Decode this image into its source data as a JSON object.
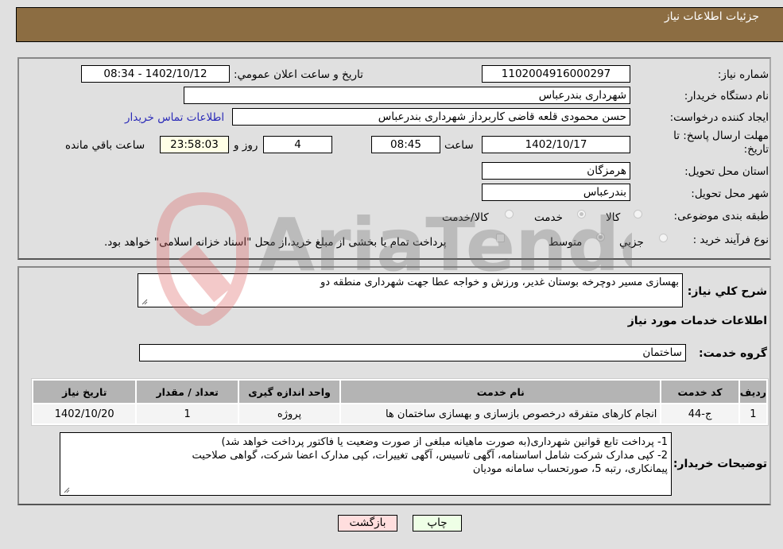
{
  "header": {
    "title": "جزئیات اطلاعات نیاز"
  },
  "details": {
    "need_number_label": "شماره نیاز:",
    "need_number": "1102004916000297",
    "announce_label": "تاریخ و ساعت اعلان عمومي:",
    "announce_value": "1402/10/12 - 08:34",
    "buyer_org_label": "نام دستگاه خريدار:",
    "buyer_org": "شهرداری بندرعباس",
    "creator_label": "ايجاد كننده درخواست:",
    "creator": "حسن محمودی قلعه قاضی کاربرداز شهرداری بندرعباس",
    "contact_link": "اطلاعات تماس خريدار",
    "deadline_label_line1": "مهلت ارسال پاسخ: تا",
    "deadline_label_line2": "تاريخ:",
    "deadline_date": "1402/10/17",
    "time_label": "ساعت",
    "deadline_time": "08:45",
    "days_value": "4",
    "days_label": "روز و",
    "remaining_time": "23:58:03",
    "remaining_label": "ساعت باقي مانده",
    "province_label": "استان محل تحويل:",
    "province": "هرمزگان",
    "city_label": "شهر محل تحويل:",
    "city": "بندرعباس",
    "category_label": "طبقه بندی موضوعی:",
    "category_options": [
      "کالا",
      "خدمت",
      "کالا/خدمت"
    ],
    "category_selected": "خدمت",
    "process_label": "نوع فرآيند خريد :",
    "process_options": [
      "جزيي",
      "متوسط"
    ],
    "process_selected": "متوسط",
    "treasury_note": "پرداخت تمام يا بخشی از مبلغ خريد،از محل \"اسناد خزانه اسلامی\" خواهد بود."
  },
  "description": {
    "label": "شرح كلي نياز:",
    "value": "بهسازی مسیر دوچرخه بوستان غدیر، ورزش و خواجه عطا جهت شهرداری منطقه دو"
  },
  "services": {
    "section_title": "اطلاعات خدمات مورد نياز",
    "group_label": "گروه خدمت:",
    "group_value": "ساختمان",
    "columns": [
      "رديف",
      "كد خدمت",
      "نام خدمت",
      "واحد اندازه گيری",
      "تعداد / مقدار",
      "تاريخ نياز"
    ],
    "rows": [
      {
        "index": "1",
        "code": "ج-44",
        "name": "انجام کارهای متفرقه درخصوص بازسازی و بهسازی ساختمان ها",
        "unit": "پروژه",
        "qty": "1",
        "date": "1402/10/20"
      }
    ]
  },
  "buyer_notes": {
    "label": "توضيحات خريدار:",
    "lines": [
      "1- پرداخت تابع قوانین شهرداری(به صورت ماهیانه مبلغی از صورت وضعیت یا فاکتور پرداخت خواهد شد)",
      "2- کپی مدارک شرکت شامل اساسنامه، آگهی تاسیس، آگهی تغییرات، کپی مدارک اعضا شرکت، گواهی صلاحیت",
      "پیمانکاری، رتبه 5، صورتحساب سامانه مودیان"
    ]
  },
  "buttons": {
    "print": "چاپ",
    "back": "بازگشت"
  },
  "colors": {
    "header": "#8c6d42",
    "print_bg": "#eeffe6",
    "back_bg": "#ffdede",
    "link": "#2a2ab8"
  },
  "watermark": {
    "text": "AriaTender.neT"
  }
}
